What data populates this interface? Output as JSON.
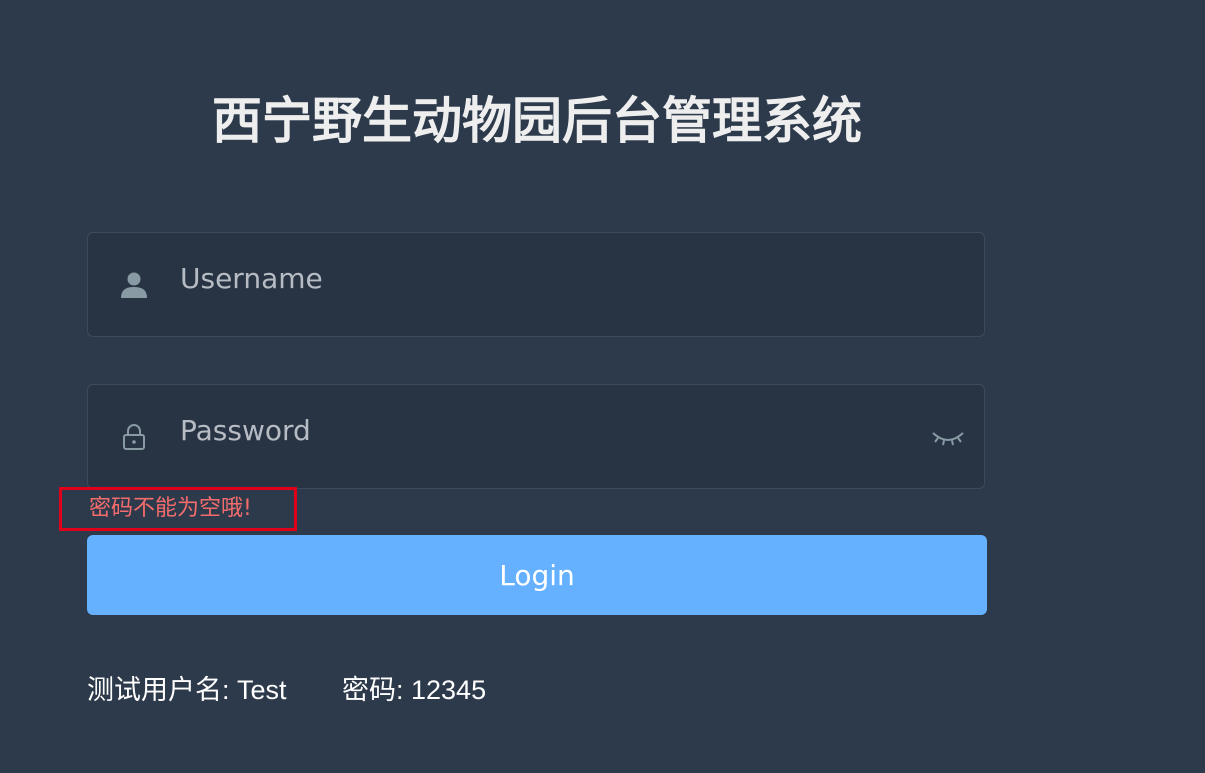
{
  "title": "西宁野生动物园后台管理系统",
  "form": {
    "username": {
      "placeholder": "Username",
      "value": "",
      "icon": "user-icon"
    },
    "password": {
      "placeholder": "Password",
      "value": "",
      "icon": "lock-icon",
      "toggle_icon": "eye-closed-icon"
    },
    "error_message": "密码不能为空哦!",
    "login_label": "Login"
  },
  "hints": {
    "username_hint": "测试用户名: Test",
    "password_hint": "密码: 12345"
  },
  "colors": {
    "background": "#2d3a4b",
    "input_background": "#283443",
    "button": "#66b1ff",
    "error": "#f56c6c",
    "highlight_box": "#e0001a"
  }
}
